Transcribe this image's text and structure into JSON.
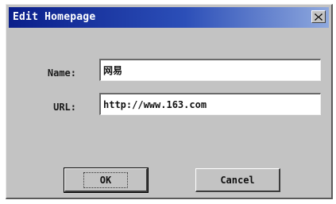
{
  "window": {
    "title": "Edit Homepage",
    "close_icon": "close-icon"
  },
  "form": {
    "name_label": "Name:",
    "name_value": "网易",
    "url_label": "URL:",
    "url_value": "http://www.163.com"
  },
  "buttons": {
    "ok_label": "OK",
    "cancel_label": "Cancel"
  },
  "colors": {
    "titlebar_start": "#0a1e8a",
    "titlebar_end": "#8fa9de",
    "face": "#c3c3c3"
  }
}
